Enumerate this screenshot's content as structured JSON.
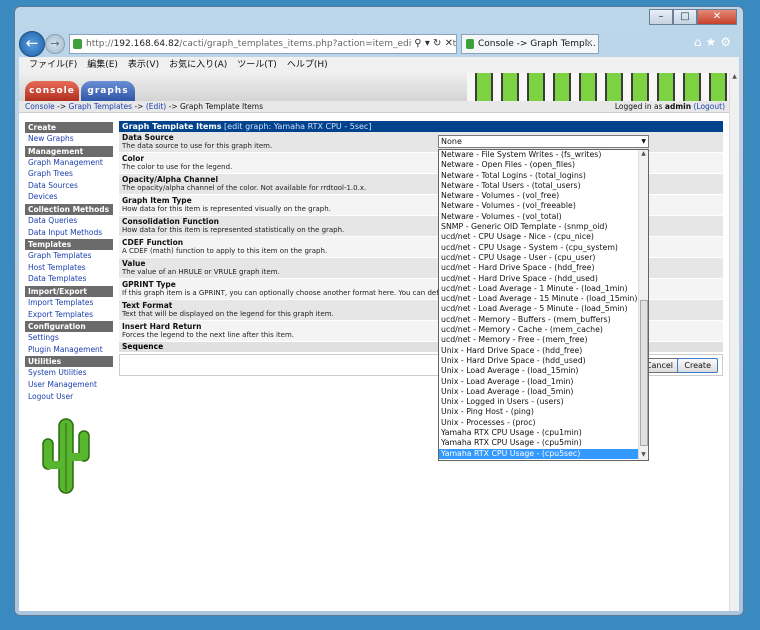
{
  "browser": {
    "back_icon": "back-arrow-icon",
    "url_host": "192.168.64.82",
    "url_rest": "/cacti/graph_templates_items.php?action=item_edit&graph_tem",
    "url_prefix": "http://",
    "tab_title": "Console -> Graph Templ...",
    "menu": [
      "ファイル(F)",
      "編集(E)",
      "表示(V)",
      "お気に入り(A)",
      "ツール(T)",
      "ヘルプ(H)"
    ]
  },
  "cacti": {
    "tabs": {
      "console": "console",
      "graphs": "graphs"
    },
    "breadcrumb": {
      "console": "Console",
      "sep1": " -> ",
      "graph_templates": "Graph Templates",
      "sep2": " -> ",
      "edit": "(Edit)",
      "sep3": " -> ",
      "current": "Graph Template Items"
    },
    "login": {
      "prefix": "Logged in as ",
      "user": "admin",
      "logout": "(Logout)"
    }
  },
  "sidebar": [
    {
      "type": "head",
      "label": "Create"
    },
    {
      "type": "item",
      "label": "New Graphs"
    },
    {
      "type": "head",
      "label": "Management"
    },
    {
      "type": "item",
      "label": "Graph Management"
    },
    {
      "type": "item",
      "label": "Graph Trees"
    },
    {
      "type": "item",
      "label": "Data Sources"
    },
    {
      "type": "item",
      "label": "Devices"
    },
    {
      "type": "head",
      "label": "Collection Methods"
    },
    {
      "type": "item",
      "label": "Data Queries"
    },
    {
      "type": "item",
      "label": "Data Input Methods"
    },
    {
      "type": "head",
      "label": "Templates"
    },
    {
      "type": "item",
      "label": "Graph Templates"
    },
    {
      "type": "item",
      "label": "Host Templates"
    },
    {
      "type": "item",
      "label": "Data Templates"
    },
    {
      "type": "head",
      "label": "Import/Export"
    },
    {
      "type": "item",
      "label": "Import Templates"
    },
    {
      "type": "item",
      "label": "Export Templates"
    },
    {
      "type": "head",
      "label": "Configuration"
    },
    {
      "type": "item",
      "label": "Settings"
    },
    {
      "type": "item",
      "label": "Plugin Management"
    },
    {
      "type": "head",
      "label": "Utilities"
    },
    {
      "type": "item",
      "label": "System Utilities"
    },
    {
      "type": "item",
      "label": "User Management"
    },
    {
      "type": "item",
      "label": "Logout User"
    }
  ],
  "form": {
    "title": "Graph Template Items",
    "subtitle": " [edit graph: Yamaha RTX CPU - 5sec]",
    "fields": [
      {
        "label": "Data Source",
        "desc": "The data source to use for this graph item."
      },
      {
        "label": "Color",
        "desc": "The color to use for the legend."
      },
      {
        "label": "Opacity/Alpha Channel",
        "desc": "The opacity/alpha channel of the color. Not available for rrdtool-1.0.x."
      },
      {
        "label": "Graph Item Type",
        "desc": "How data for this item is represented visually on the graph."
      },
      {
        "label": "Consolidation Function",
        "desc": "How data for this item is represented statistically on the graph."
      },
      {
        "label": "CDEF Function",
        "desc": "A CDEF (math) function to apply to this item on the graph."
      },
      {
        "label": "Value",
        "desc": "The value of an HRULE or VRULE graph item."
      },
      {
        "label": "GPRINT Type",
        "desc": "If this graph item is a GPRINT, you can optionally choose another format here. You can define additional types under \"GPRINT Presets\"."
      },
      {
        "label": "Text Format",
        "desc": "Text that will be displayed on the legend for this graph item."
      },
      {
        "label": "Insert Hard Return",
        "desc": "Forces the legend to the next line after this item."
      }
    ],
    "sequence_label": "Sequence",
    "data_source_value": "None",
    "cancel_label": "Cancel",
    "create_label": "Create"
  },
  "dropdown_options": [
    "Netware - File System Writes - (fs_writes)",
    "Netware - Open Files - (open_files)",
    "Netware - Total Logins - (total_logins)",
    "Netware - Total Users - (total_users)",
    "Netware - Volumes - (vol_free)",
    "Netware - Volumes - (vol_freeable)",
    "Netware - Volumes - (vol_total)",
    "SNMP - Generic OID Template - (snmp_oid)",
    "ucd/net - CPU Usage - Nice - (cpu_nice)",
    "ucd/net - CPU Usage - System - (cpu_system)",
    "ucd/net - CPU Usage - User - (cpu_user)",
    "ucd/net - Hard Drive Space - (hdd_free)",
    "ucd/net - Hard Drive Space - (hdd_used)",
    "ucd/net - Load Average - 1 Minute - (load_1min)",
    "ucd/net - Load Average - 15 Minute - (load_15min)",
    "ucd/net - Load Average - 5 Minute - (load_5min)",
    "ucd/net - Memory - Buffers - (mem_buffers)",
    "ucd/net - Memory - Cache - (mem_cache)",
    "ucd/net - Memory - Free - (mem_free)",
    "Unix - Hard Drive Space - (hdd_free)",
    "Unix - Hard Drive Space - (hdd_used)",
    "Unix - Load Average - (load_15min)",
    "Unix - Load Average - (load_1min)",
    "Unix - Load Average - (load_5min)",
    "Unix - Logged in Users - (users)",
    "Unix - Ping Host - (ping)",
    "Unix - Processes - (proc)",
    "Yamaha RTX CPU Usage - (cpu1min)",
    "Yamaha RTX CPU Usage - (cpu5min)",
    "Yamaha RTX CPU Usage - (cpu5sec)"
  ],
  "selected_option": "Yamaha RTX CPU Usage - (cpu5sec)"
}
